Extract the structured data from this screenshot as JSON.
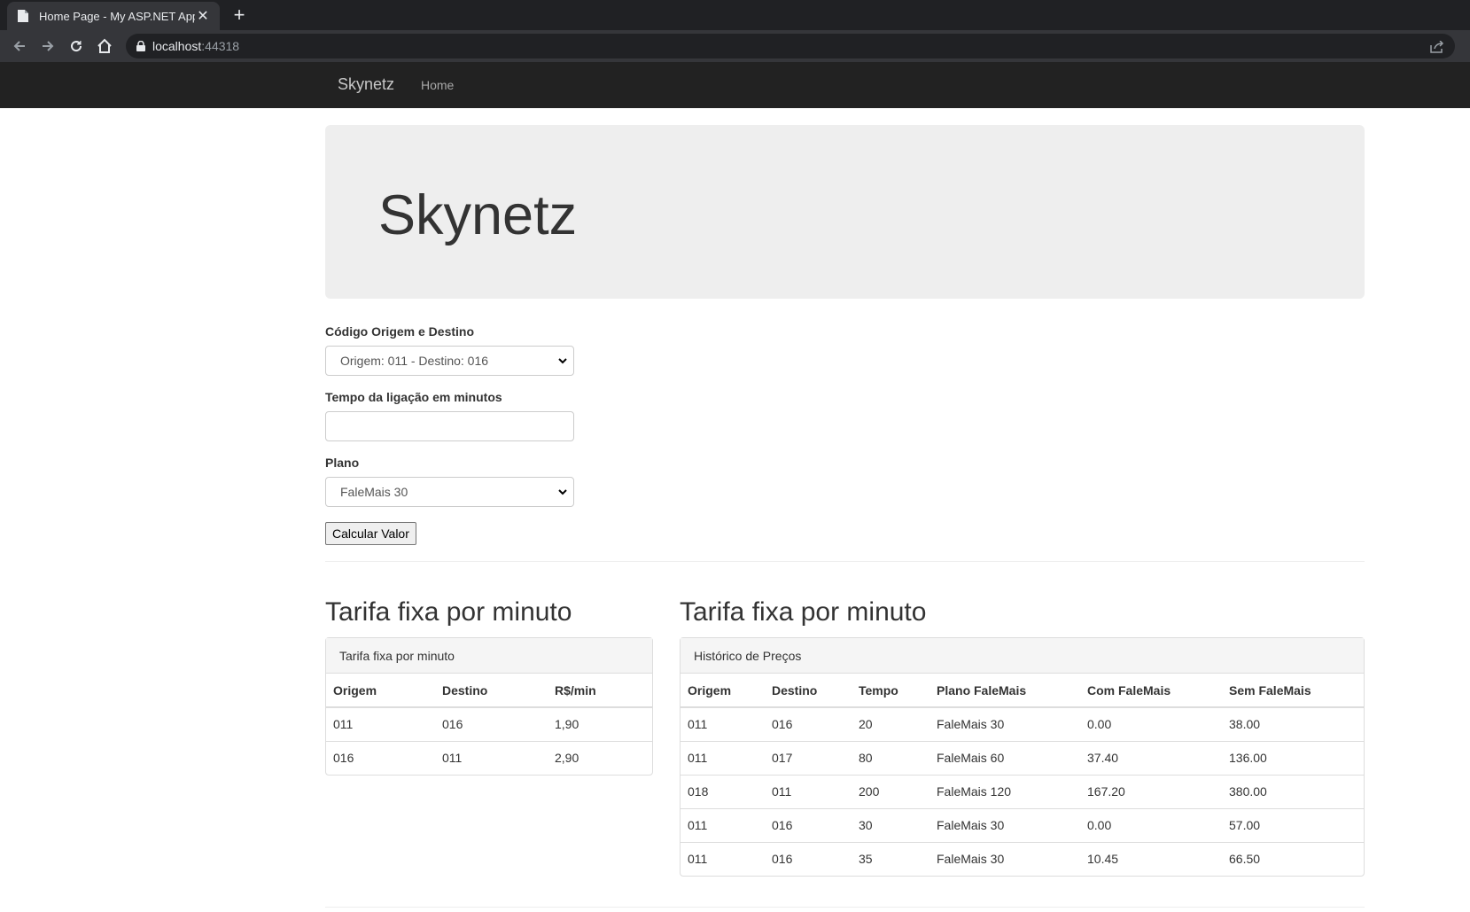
{
  "browser": {
    "tab_title": "Home Page - My ASP.NET Applic",
    "url_host": "localhost",
    "url_port": ":44318"
  },
  "navbar": {
    "brand": "Skynetz",
    "home": "Home"
  },
  "jumbotron": {
    "title": "Skynetz"
  },
  "form": {
    "origin_label": "Código Origem e Destino",
    "origin_value": "Origem: 011 - Destino: 016",
    "time_label": "Tempo da ligação em minutos",
    "time_value": "",
    "plan_label": "Plano",
    "plan_value": "FaleMais 30",
    "submit_label": "Calcular Valor"
  },
  "rates": {
    "heading": "Tarifa fixa por minuto",
    "panel_title": "Tarifa fixa por minuto",
    "columns": [
      "Origem",
      "Destino",
      "R$/min"
    ],
    "rows": [
      [
        "011",
        "016",
        "1,90"
      ],
      [
        "016",
        "011",
        "2,90"
      ]
    ]
  },
  "history": {
    "heading": "Tarifa fixa por minuto",
    "panel_title": "Histórico de Preços",
    "columns": [
      "Origem",
      "Destino",
      "Tempo",
      "Plano FaleMais",
      "Com FaleMais",
      "Sem FaleMais"
    ],
    "rows": [
      [
        "011",
        "016",
        "20",
        "FaleMais 30",
        "0.00",
        "38.00"
      ],
      [
        "011",
        "017",
        "80",
        "FaleMais 60",
        "37.40",
        "136.00"
      ],
      [
        "018",
        "011",
        "200",
        "FaleMais 120",
        "167.20",
        "380.00"
      ],
      [
        "011",
        "016",
        "30",
        "FaleMais 30",
        "0.00",
        "57.00"
      ],
      [
        "011",
        "016",
        "35",
        "FaleMais 30",
        "10.45",
        "66.50"
      ]
    ]
  }
}
